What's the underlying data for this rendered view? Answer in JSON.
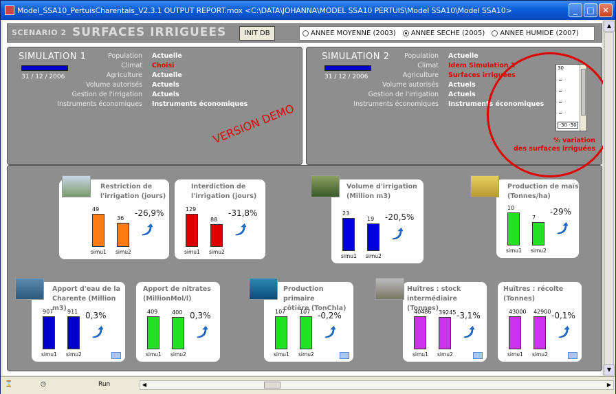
{
  "window": {
    "title": "Model_SSA10_PertuisCharentais_V2.3.1 OUTPUT REPORT.mox   <C:\\DATA\\JOHANNA\\MODEL SSA10 PERTUIS\\Model SSA10\\Model SSA10>"
  },
  "header": {
    "scenario_prefix": "SCENARIO 2",
    "scenario_name": "SURFACES IRRIGUEES",
    "init_button": "INIT DB",
    "radios": [
      {
        "label": "ANNEE MOYENNE (2003)",
        "selected": false
      },
      {
        "label": "ANNEE SECHE (2005)",
        "selected": true
      },
      {
        "label": "ANNEE HUMIDE (2007)",
        "selected": false
      }
    ]
  },
  "sim1": {
    "title": "SIMULATION 1",
    "date": "31 / 12 / 2006",
    "params": [
      {
        "label": "Population",
        "value": "Actuelle",
        "red": false
      },
      {
        "label": "Climat",
        "value": "Choisi",
        "red": true
      },
      {
        "label": "Agriculture",
        "value": "Actuelle",
        "red": false
      },
      {
        "label": "Volume autorisés",
        "value": "Actuels",
        "red": false
      },
      {
        "label": "Gestion de l'irrigation",
        "value": "Actuels",
        "red": false
      },
      {
        "label": "Instruments économiques",
        "value": "Instruments économiques",
        "red": false
      }
    ],
    "watermark": "VERSION DEMO"
  },
  "sim2": {
    "title": "SIMULATION 2",
    "date": "31 / 12 / 2006",
    "params": [
      {
        "label": "Population",
        "value": "Actuelle",
        "red": false
      },
      {
        "label": "Climat",
        "value": "Idem Simulation 1",
        "red": true
      },
      {
        "label": "Agriculture",
        "value": "Surfaces irriguées",
        "red": true
      },
      {
        "label": "Volume autorisés",
        "value": "Actuels",
        "red": false
      },
      {
        "label": "Gestion de l'irrigation",
        "value": "Actuels",
        "red": false
      },
      {
        "label": "Instruments économiques",
        "value": "Instruments économiques",
        "red": false
      }
    ],
    "slider": {
      "top_value": "30",
      "bottom_value": "-30  -30"
    },
    "variation_label_1": "% variation",
    "variation_label_2": "des surfaces irriguées"
  },
  "cards": [
    {
      "title1": "Restriction de",
      "title2": "l'irrigation (jours)",
      "v1": "49",
      "v2": "36",
      "pct": "-26,9%",
      "color": "#ff7a10",
      "l1": "simu1",
      "l2": "simu2"
    },
    {
      "title1": "Interdiction de",
      "title2": "l'irrigation (jours)",
      "v1": "129",
      "v2": "88",
      "pct": "-31,8%",
      "color": "#dd0000",
      "l1": "simu1",
      "l2": "simu2"
    },
    {
      "title1": "Volume d'irrigation",
      "title2": "(Million m3)",
      "v1": "23",
      "v2": "19",
      "pct": "-20,5%",
      "color": "#0000dd",
      "l1": "simu1",
      "l2": "simu2"
    },
    {
      "title1": "Production de maïs",
      "title2": "(Tonnes/ha)",
      "v1": "10",
      "v2": "7",
      "pct": "-29%",
      "color": "#22e022",
      "l1": "simu1",
      "l2": "simu2"
    },
    {
      "title1": "Apport d'eau de la",
      "title2": "Charente (Million m3)",
      "v1": "907",
      "v2": "911",
      "pct": "0,3%",
      "color": "#0000cc",
      "l1": "simu1",
      "l2": "simu2"
    },
    {
      "title1": "Apport de nitrates",
      "title2": "(MillionMol/l)",
      "v1": "409",
      "v2": "400",
      "pct": "0,3%",
      "color": "#22e022",
      "l1": "simu1",
      "l2": "simu2"
    },
    {
      "title1": "Production primaire",
      "title2": "côtière (TonChla)",
      "v1": "107",
      "v2": "107",
      "pct": "-0,2%",
      "color": "#22e022",
      "l1": "simu1",
      "l2": "simu2"
    },
    {
      "title1": "Huîtres : stock",
      "title2": "intermédiaire (Tonnes)",
      "v1": "40486",
      "v2": "39245",
      "pct": "-3,1%",
      "color": "#cc33ee",
      "l1": "simu1",
      "l2": "simu2"
    },
    {
      "title1": "Huîtres : récolte",
      "title2": "(Tonnes)",
      "v1": "43000",
      "v2": "42900",
      "pct": "-0,1%",
      "color": "#cc33ee",
      "l1": "simu1",
      "l2": "simu2"
    }
  ],
  "status": {
    "run_label": "Run"
  }
}
